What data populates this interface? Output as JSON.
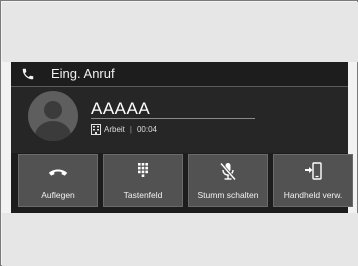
{
  "header": {
    "title": "Eing. Anruf",
    "icon": "phone-icon"
  },
  "caller": {
    "name": "AAAAA",
    "type_icon": "building-icon",
    "type": "Arbeit",
    "separator": "|",
    "duration": "00:04"
  },
  "buttons": [
    {
      "label": "Auflegen",
      "icon": "hang-up-icon"
    },
    {
      "label": "Tastenfeld",
      "icon": "keypad-icon"
    },
    {
      "label": "Stumm schalten",
      "icon": "mute-icon"
    },
    {
      "label": "Handheld verw.",
      "icon": "handheld-transfer-icon"
    }
  ],
  "colors": {
    "screen_bg": "#1d1d1d",
    "button_bg": "#525252",
    "text": "#f2f2f2"
  }
}
